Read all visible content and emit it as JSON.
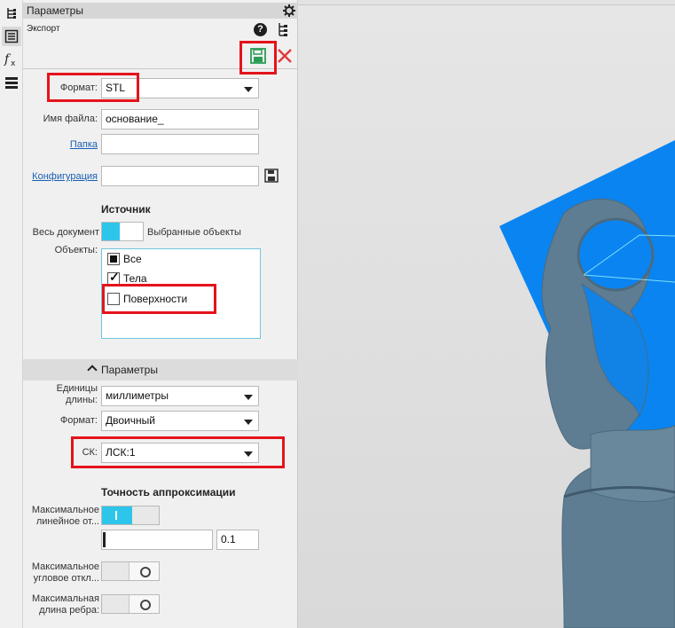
{
  "panel": {
    "title": "Параметры",
    "subtitle": "Экспорт"
  },
  "export": {
    "format_label": "Формат:",
    "format_value": "STL",
    "filename_label": "Имя файла:",
    "filename_value": "основание_",
    "folder_label": "Папка",
    "folder_value": "",
    "config_label": "Конфигурация",
    "config_value": ""
  },
  "source": {
    "heading": "Источник",
    "whole_doc_label": "Весь документ",
    "selected_label": "Выбранные объекты",
    "objects_label": "Объекты:",
    "items": [
      {
        "label": "Все",
        "state": "partial"
      },
      {
        "label": "Тела",
        "state": "checked"
      },
      {
        "label": "Поверхности",
        "state": "unchecked"
      }
    ]
  },
  "params": {
    "section_label": "Параметры",
    "units_label": "Единицы длины:",
    "units_value": "миллиметры",
    "format_label": "Формат:",
    "format_value": "Двоичный",
    "cs_label": "СК:",
    "cs_value": "ЛСК:1"
  },
  "accuracy": {
    "heading": "Точность аппроксимации",
    "linear_label": "Максимальное линейное от...",
    "linear_value": "0.1",
    "angular_label": "Максимальное угловое откл...",
    "edge_label": "Максимальная длина ребра:"
  },
  "colors": {
    "accent": "#2ec5ea",
    "highlight": "#e5131b",
    "model_plane": "#0a84f0",
    "model_body": "#5f7d92"
  }
}
